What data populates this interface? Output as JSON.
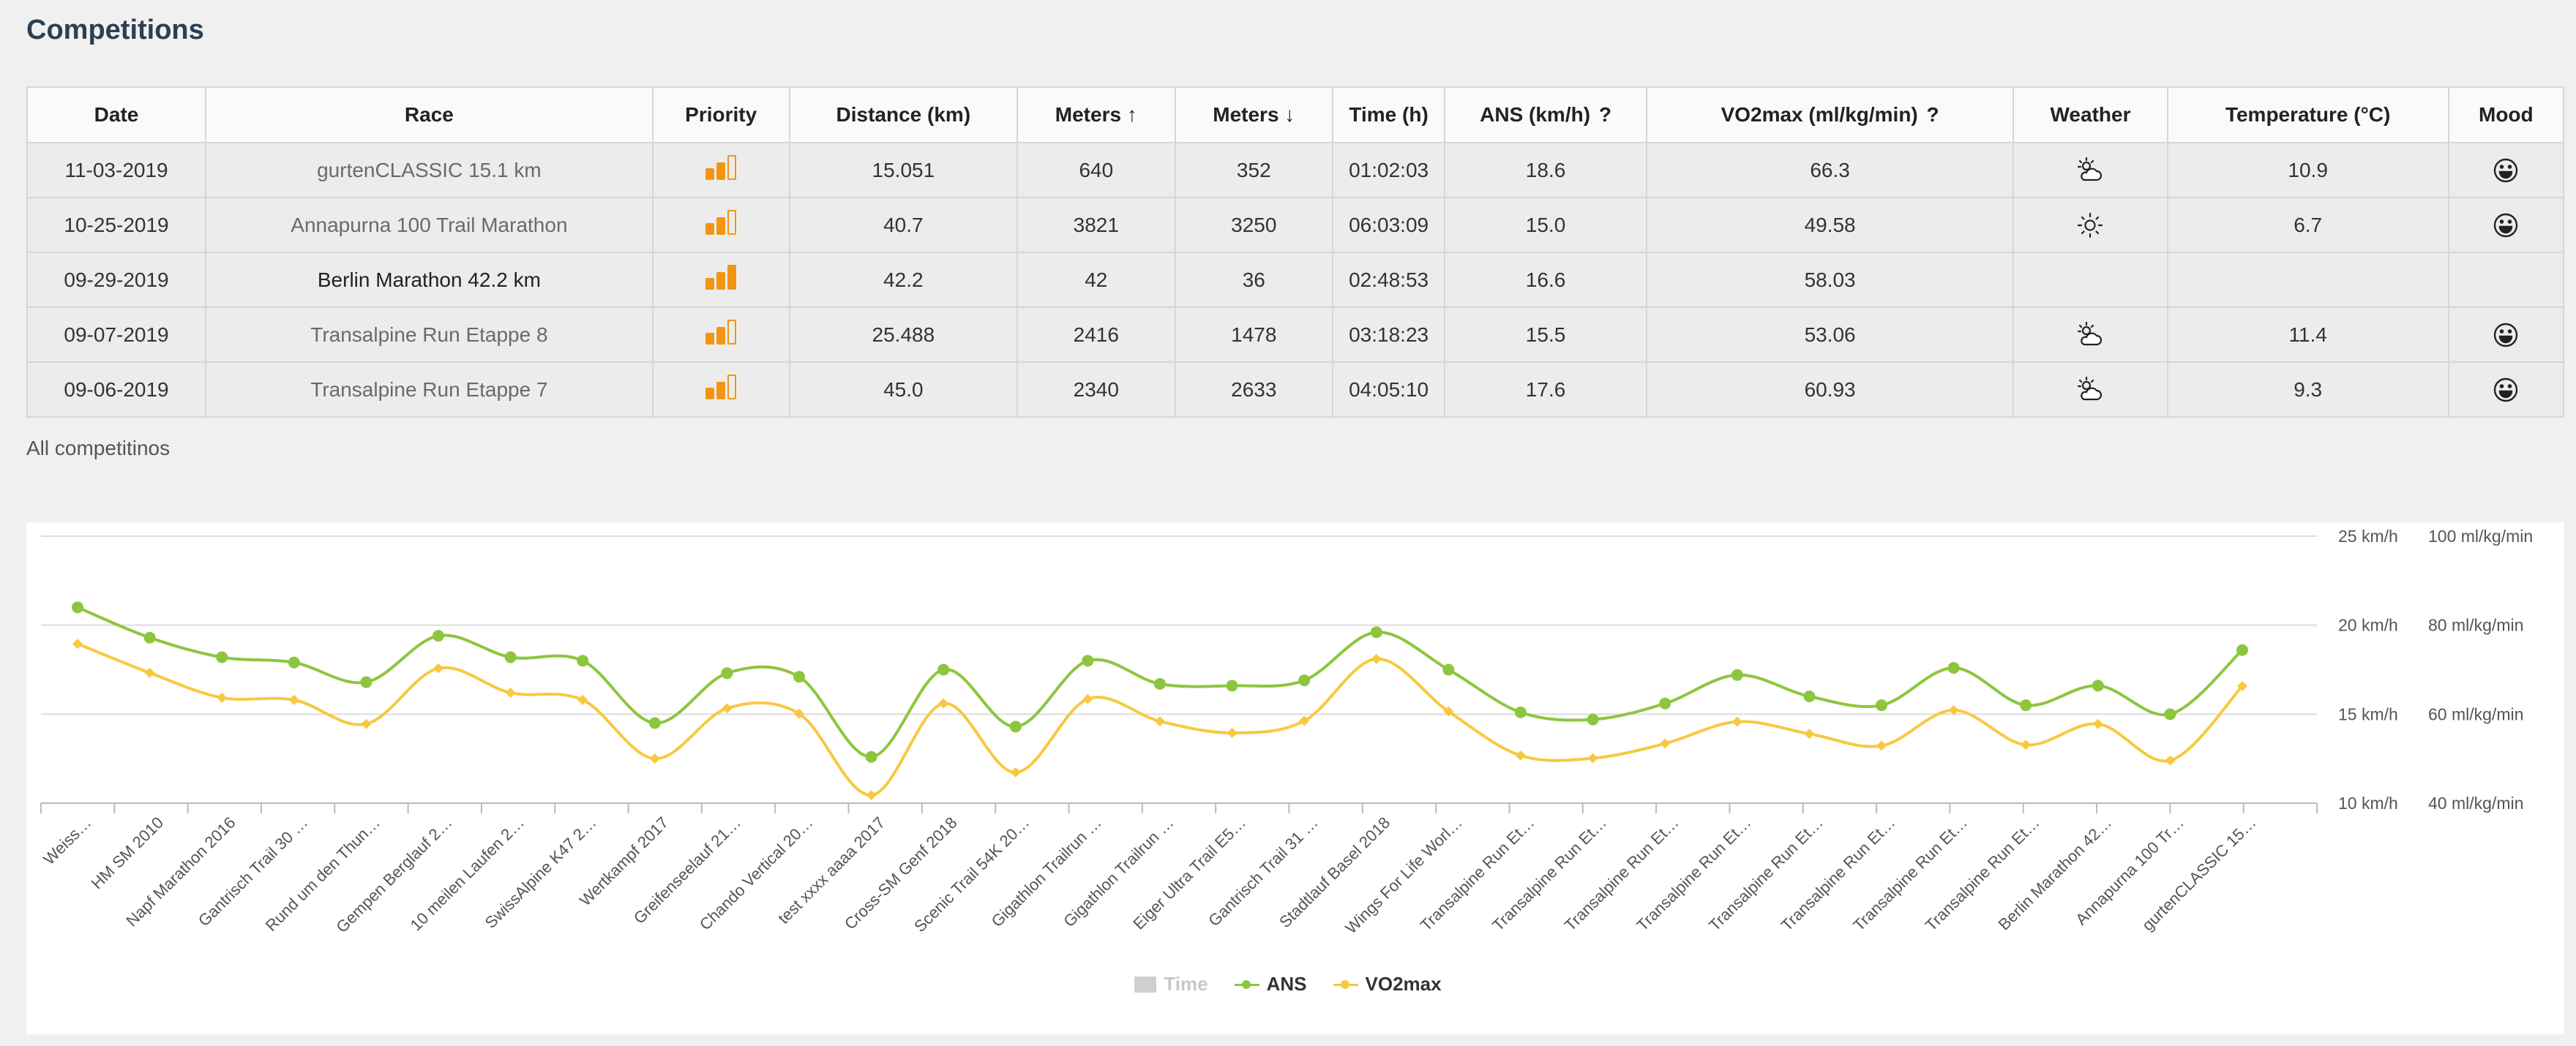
{
  "page": {
    "title": "Competitions",
    "all_link": "All competitinos"
  },
  "table": {
    "headers": {
      "date": "Date",
      "race": "Race",
      "priority": "Priority",
      "distance": "Distance (km)",
      "meters_up": "Meters ↑",
      "meters_down": "Meters ↓",
      "time": "Time (h)",
      "ans": "ANS (km/h)",
      "ans_help": "?",
      "vo2max": "VO2max (ml/kg/min)",
      "vo2max_help": "?",
      "weather": "Weather",
      "temperature": "Temperature (°C)",
      "mood": "Mood"
    },
    "rows": [
      {
        "date": "11-03-2019",
        "race": "gurtenCLASSIC 15.1 km",
        "priority": 2,
        "distance": "15.051",
        "up": "640",
        "down": "352",
        "time": "01:02:03",
        "ans": "18.6",
        "vo2": "66.3",
        "weather": "partly-cloudy-icon",
        "temp": "10.9",
        "mood": "smiley-icon"
      },
      {
        "date": "10-25-2019",
        "race": "Annapurna 100 Trail Marathon",
        "priority": 2,
        "distance": "40.7",
        "up": "3821",
        "down": "3250",
        "time": "06:03:09",
        "ans": "15.0",
        "vo2": "49.58",
        "weather": "sun-icon",
        "temp": "6.7",
        "mood": "smiley-icon"
      },
      {
        "date": "09-29-2019",
        "race": "Berlin Marathon 42.2 km",
        "priority": 3,
        "distance": "42.2",
        "up": "42",
        "down": "36",
        "time": "02:48:53",
        "ans": "16.6",
        "vo2": "58.03",
        "weather": "",
        "temp": "",
        "mood": ""
      },
      {
        "date": "09-07-2019",
        "race": "Transalpine Run Etappe 8",
        "priority": 2,
        "distance": "25.488",
        "up": "2416",
        "down": "1478",
        "time": "03:18:23",
        "ans": "15.5",
        "vo2": "53.06",
        "weather": "partly-cloudy-icon",
        "temp": "11.4",
        "mood": "smiley-icon"
      },
      {
        "date": "09-06-2019",
        "race": "Transalpine Run Etappe 7",
        "priority": 2,
        "distance": "45.0",
        "up": "2340",
        "down": "2633",
        "time": "04:05:10",
        "ans": "17.6",
        "vo2": "60.93",
        "weather": "partly-cloudy-icon",
        "temp": "9.3",
        "mood": "smiley-icon"
      }
    ]
  },
  "colors": {
    "priority": "#f29512",
    "ans": "#8cc63e",
    "vo2max": "#f7c940",
    "time": "#cfcfcf",
    "grid": "#dcdcdc",
    "title": "#2d3e50"
  },
  "chart_data": {
    "type": "line",
    "categories": [
      "Weiss…",
      "HM SM 2010",
      "Napf Marathon 2016",
      "Gantrisch Trail 30 …",
      "Rund um den Thun…",
      "Gempen Berglauf 2…",
      "10 meilen Laufen 2…",
      "SwissAlpine K47 2…",
      "Wertkampf 2017",
      "Greifenseelauf 21…",
      "Chando Vertical 20…",
      "test xxxx aaaa 2017",
      "Cross-SM Genf 2018",
      "Scenic Trail 54K 20…",
      "Gigathlon Trailrun …",
      "Gigathlon Trailrun …",
      "Eiger Ultra Trail E5…",
      "Gantrisch Trail 31 …",
      "Stadtlauf Basel 2018",
      "Wings For Life Worl…",
      "Transalpine Run Et…",
      "Transalpine Run Et…",
      "Transalpine Run Et…",
      "Transalpine Run Et…",
      "Transalpine Run Et…",
      "Transalpine Run Et…",
      "Transalpine Run Et…",
      "Transalpine Run Et…",
      "Berlin Marathon 42…",
      "Annapurna 100 Tr…",
      "gurtenCLASSIC 15…"
    ],
    "series": [
      {
        "name": "ANS",
        "axis": "left",
        "values": [
          21.0,
          19.3,
          18.2,
          17.9,
          16.8,
          19.4,
          18.2,
          18.0,
          14.5,
          17.3,
          17.1,
          12.6,
          17.5,
          14.3,
          18.0,
          16.7,
          16.6,
          16.9,
          19.6,
          17.5,
          15.1,
          14.7,
          15.6,
          17.2,
          16.0,
          15.5,
          17.6,
          15.5,
          16.6,
          15.0,
          18.6
        ]
      },
      {
        "name": "VO2max",
        "axis": "right",
        "values": [
          75.8,
          69.3,
          63.7,
          63.2,
          57.8,
          70.3,
          64.8,
          63.2,
          50.0,
          61.3,
          60.1,
          41.8,
          62.4,
          46.9,
          63.4,
          58.4,
          55.8,
          58.5,
          72.4,
          60.6,
          50.7,
          50.1,
          53.4,
          58.3,
          55.6,
          52.9,
          60.9,
          53.1,
          57.8,
          49.6,
          66.3
        ]
      }
    ],
    "legend": [
      {
        "name": "Time",
        "enabled": false
      },
      {
        "name": "ANS",
        "enabled": true
      },
      {
        "name": "VO2max",
        "enabled": true
      }
    ],
    "axes": {
      "left": {
        "ylim": [
          10,
          25
        ],
        "ticks": [
          {
            "value": 25,
            "label": "25 km/h"
          },
          {
            "value": 20,
            "label": "20 km/h"
          },
          {
            "value": 15,
            "label": "15 km/h"
          },
          {
            "value": 10,
            "label": "10 km/h"
          }
        ]
      },
      "right": {
        "ylim": [
          40,
          100
        ],
        "ticks": [
          {
            "value": 100,
            "label": "100 ml/kg/min"
          },
          {
            "value": 80,
            "label": "80 ml/kg/min"
          },
          {
            "value": 60,
            "label": "60 ml/kg/min"
          },
          {
            "value": 40,
            "label": "40 ml/kg/min"
          }
        ]
      }
    },
    "grid": true,
    "legend_position": "bottom"
  }
}
